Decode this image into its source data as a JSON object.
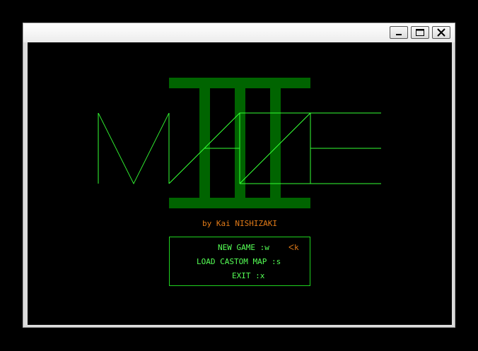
{
  "window": {
    "controls": [
      "minimize-icon",
      "maximize-icon",
      "close-icon"
    ]
  },
  "title_screen": {
    "logo_letters": [
      "M",
      "A",
      "Z",
      "E"
    ],
    "logo_numeral": "III",
    "author": "by Kai NISHIZAKI",
    "menu": [
      {
        "label": "NEW GAME :w"
      },
      {
        "label": "LOAD CASTOM MAP :s"
      },
      {
        "label": "EXIT :x"
      }
    ],
    "cursor": "ᐸk",
    "selected_index": 0
  },
  "colors": {
    "background": "#000000",
    "logo_lines": "#33ff33",
    "numeral": "#006400",
    "menu_text": "#55ff55",
    "menu_border": "#1fd21f",
    "author_text": "#e07a18",
    "cursor": "#e07a18"
  }
}
